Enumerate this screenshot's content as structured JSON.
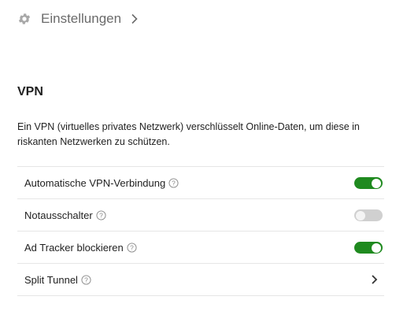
{
  "breadcrumb": {
    "icon": "gear-icon",
    "label": "Einstellungen"
  },
  "section": {
    "title": "VPN",
    "description": "Ein VPN (virtuelles privates Netzwerk) verschlüsselt Online-Daten, um diese in riskanten Netzwerken zu schützen."
  },
  "settings": [
    {
      "label": "Automatische VPN-Verbindung",
      "control": "toggle",
      "state": "on"
    },
    {
      "label": "Notausschalter",
      "control": "toggle",
      "state": "off"
    },
    {
      "label": "Ad Tracker blockieren",
      "control": "toggle",
      "state": "on"
    },
    {
      "label": "Split Tunnel",
      "control": "chevron"
    }
  ],
  "colors": {
    "toggle_on": "#1f8a1f",
    "toggle_off": "#d0d0d0",
    "muted_text": "#6b6b6b"
  }
}
